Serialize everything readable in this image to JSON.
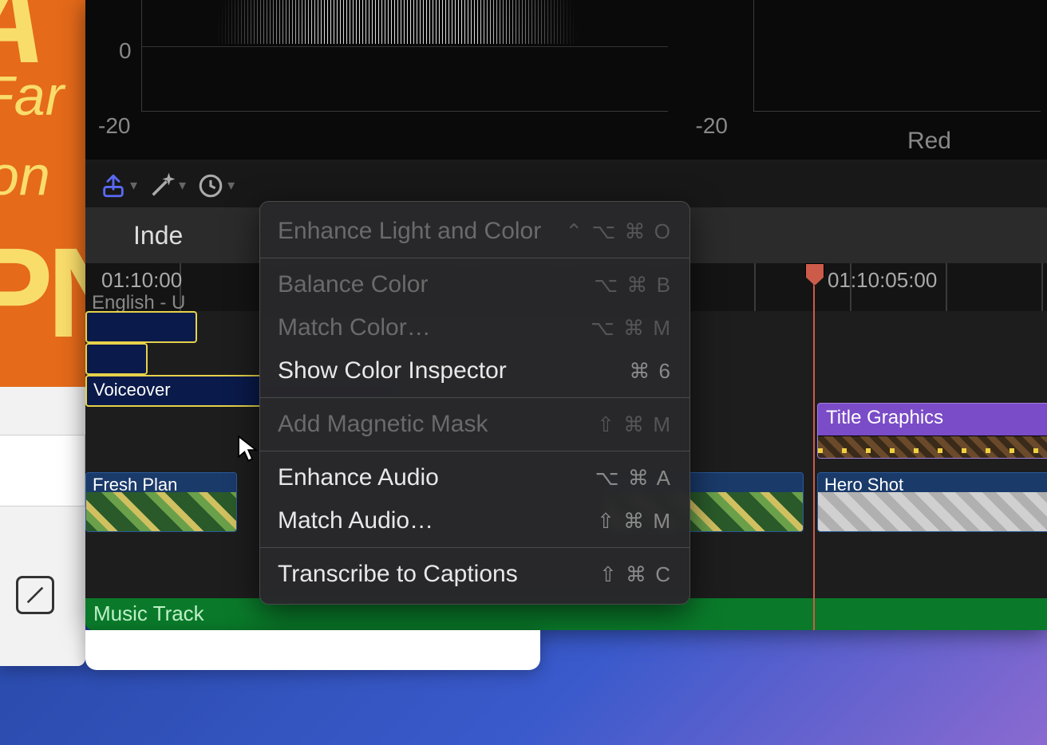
{
  "artwork": {
    "l1": "A",
    "l2": "Far",
    "l3": "tion",
    "l4": "PN"
  },
  "scopes": {
    "zero": "0",
    "minus20": "-20",
    "red": "Red"
  },
  "toolbar": {
    "index": "Inde"
  },
  "ruler": {
    "tc1": "01:10:00",
    "sub": "English - U",
    "tc2": "01:10:05:00"
  },
  "clips": {
    "titleGraphics": "Title Graphics",
    "freshPlan": "Fresh Plan",
    "heroShot": "Hero Shot",
    "voiceover": "Voiceover",
    "musicTrack": "Music Track"
  },
  "menu": {
    "enhanceLightColor": {
      "label": "Enhance Light and Color",
      "shortcut": "⌃ ⌥ ⌘ O"
    },
    "balanceColor": {
      "label": "Balance Color",
      "shortcut": "⌥ ⌘ B"
    },
    "matchColor": {
      "label": "Match Color…",
      "shortcut": "⌥ ⌘ M"
    },
    "showColorInspector": {
      "label": "Show Color Inspector",
      "shortcut": "⌘ 6"
    },
    "addMagneticMask": {
      "label": "Add Magnetic Mask",
      "shortcut": "⇧ ⌘ M"
    },
    "enhanceAudio": {
      "label": "Enhance Audio",
      "shortcut": "⌥ ⌘ A"
    },
    "matchAudio": {
      "label": "Match Audio…",
      "shortcut": "⇧ ⌘ M"
    },
    "transcribeCaptions": {
      "label": "Transcribe to Captions",
      "shortcut": "⇧ ⌘ C"
    }
  }
}
